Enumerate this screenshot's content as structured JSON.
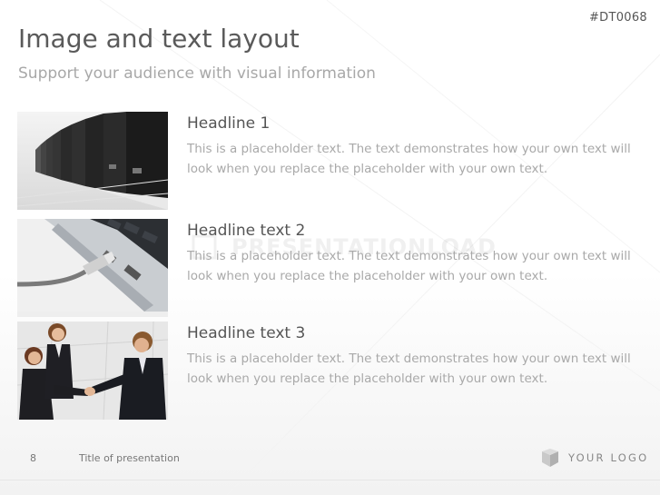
{
  "slide": {
    "code": "#DT0068",
    "title": "Image and text layout",
    "subtitle": "Support your audience with visual information"
  },
  "items": [
    {
      "headline": "Headline 1",
      "text": "This is a placeholder text. The text demonstrates how your own text will look when you replace the placeholder with your own text.",
      "image": "server-racks-photo"
    },
    {
      "headline": "Headline text 2",
      "text": "This is a placeholder text. The text demonstrates how your own text will look when you replace the placeholder with your own text.",
      "image": "network-cable-laptop-photo"
    },
    {
      "headline": "Headline text 3",
      "text": "This is a placeholder text. The text demonstrates how your own text will look when you replace the placeholder with your own text.",
      "image": "business-handshake-photo"
    }
  ],
  "watermark": "PRESENTATIONLOAD",
  "footer": {
    "page_number": "8",
    "presentation_title": "Title of presentation",
    "logo_text": "YOUR LOGO"
  },
  "colors": {
    "title": "#5a5a5a",
    "subtitle": "#a8a8a8",
    "body_text": "#a9a9a9"
  }
}
